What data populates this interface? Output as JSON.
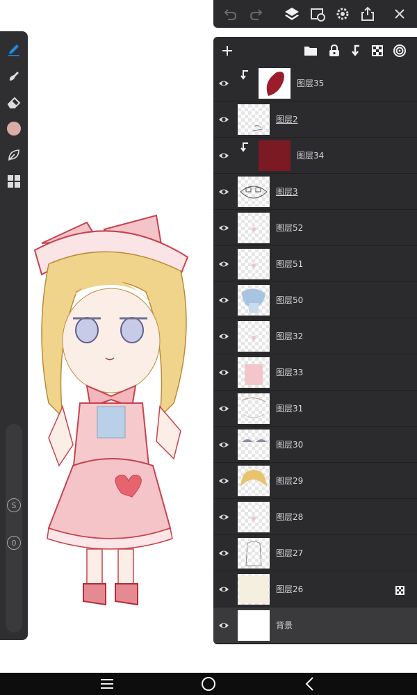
{
  "colors": {
    "accent": "#1e88e5",
    "panel_bg": "#2b2b2d",
    "current_brush_color": "#d9aca8",
    "layer34_fill": "#7c1a24"
  },
  "left_toolbar": {
    "tools": [
      "brush-icon",
      "smudge-icon",
      "eraser-icon",
      "color-swatch",
      "leaf-icon",
      "gallery-icon"
    ],
    "size_badge": "S",
    "opacity_badge": "0"
  },
  "top_toolbar": {
    "icons": [
      "undo-icon",
      "redo-icon",
      "layers-icon",
      "transform-icon",
      "settings-icon",
      "share-icon",
      "close-icon"
    ]
  },
  "layers_header": {
    "icons": [
      "add-layer-icon",
      "folder-icon",
      "lock-icon",
      "merge-down-icon",
      "transparency-icon",
      "spiral-icon"
    ]
  },
  "layers": [
    {
      "name": "图层35",
      "clipped": true,
      "underlined": false,
      "thumb": "leaf"
    },
    {
      "name": "图层2",
      "clipped": false,
      "underlined": true,
      "thumb": "sketch"
    },
    {
      "name": "图层34",
      "clipped": true,
      "underlined": false,
      "thumb": "red"
    },
    {
      "name": "图层3",
      "clipped": false,
      "underlined": true,
      "thumb": "face"
    },
    {
      "name": "图层52",
      "clipped": false,
      "underlined": false,
      "thumb": "faint"
    },
    {
      "name": "图层51",
      "clipped": false,
      "underlined": false,
      "thumb": "faint"
    },
    {
      "name": "图层50",
      "clipped": false,
      "underlined": false,
      "thumb": "blue"
    },
    {
      "name": "图层32",
      "clipped": false,
      "underlined": false,
      "thumb": "faint"
    },
    {
      "name": "图层33",
      "clipped": false,
      "underlined": false,
      "thumb": "pink"
    },
    {
      "name": "图层31",
      "clipped": false,
      "underlined": false,
      "thumb": "outline"
    },
    {
      "name": "图层30",
      "clipped": false,
      "underlined": false,
      "thumb": "grey"
    },
    {
      "name": "图层29",
      "clipped": false,
      "underlined": false,
      "thumb": "hair"
    },
    {
      "name": "图层28",
      "clipped": false,
      "underlined": false,
      "thumb": "faint"
    },
    {
      "name": "图层27",
      "clipped": false,
      "underlined": false,
      "thumb": "lineart"
    },
    {
      "name": "图层26",
      "clipped": false,
      "underlined": false,
      "thumb": "cream",
      "alpha_lock": true
    },
    {
      "name": "背景",
      "clipped": false,
      "underlined": false,
      "thumb": "white",
      "selected": true
    }
  ],
  "bottom_nav": {
    "icons": [
      "menu-icon",
      "home-icon",
      "back-icon"
    ]
  }
}
